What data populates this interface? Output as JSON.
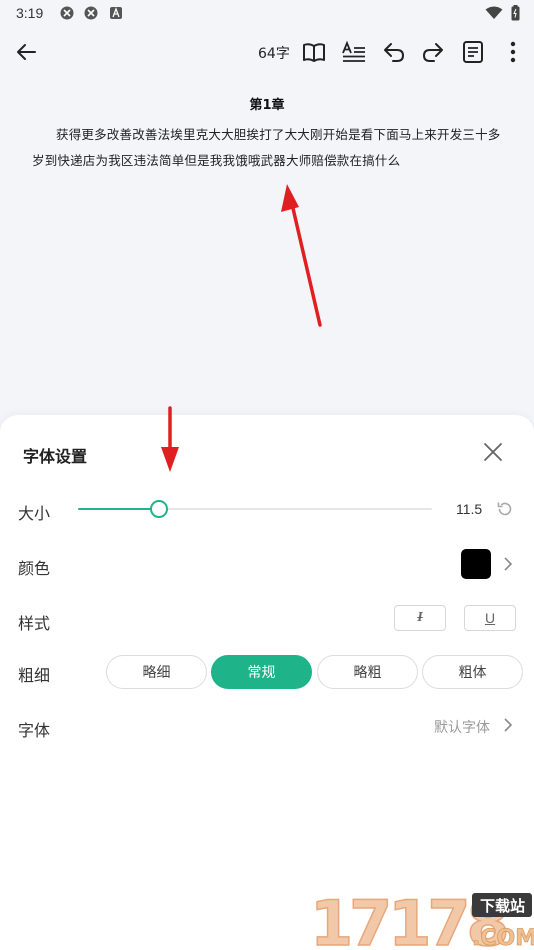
{
  "status_bar": {
    "time": "3:19",
    "icons": [
      "app-icon-1",
      "app-icon-2",
      "a-icon",
      "wifi-icon",
      "battery-icon"
    ]
  },
  "toolbar": {
    "word_count": "64字",
    "buttons": [
      "back-icon",
      "book-icon",
      "format-text-icon",
      "undo-icon",
      "redo-icon",
      "note-icon",
      "more-icon"
    ]
  },
  "document": {
    "title": "第1章",
    "body": "获得更多改善改善法埃里克大大胆挨打了大大刚开始是看下面马上来开发三十多岁到快递店为我区违法简单但是我我饿哦武器大师赔偿款在搞什么"
  },
  "font_settings": {
    "title": "字体设置",
    "size": {
      "label": "大小",
      "value": "11.5",
      "slider_fraction": 0.23
    },
    "color": {
      "label": "颜色",
      "value_hex": "#000000"
    },
    "style": {
      "label": "样式",
      "italic_label": "I",
      "underline_label": "U"
    },
    "weight": {
      "label": "粗细",
      "options": [
        "略细",
        "常规",
        "略粗",
        "粗体"
      ],
      "selected_index": 1
    },
    "font": {
      "label": "字体",
      "value": "默认字体"
    }
  },
  "colors": {
    "accent": "#1fb38a",
    "annotation_arrow": "#e02020"
  },
  "watermark": {
    "text": "17178",
    "badge": "下载站",
    "suffix": ".COM"
  }
}
